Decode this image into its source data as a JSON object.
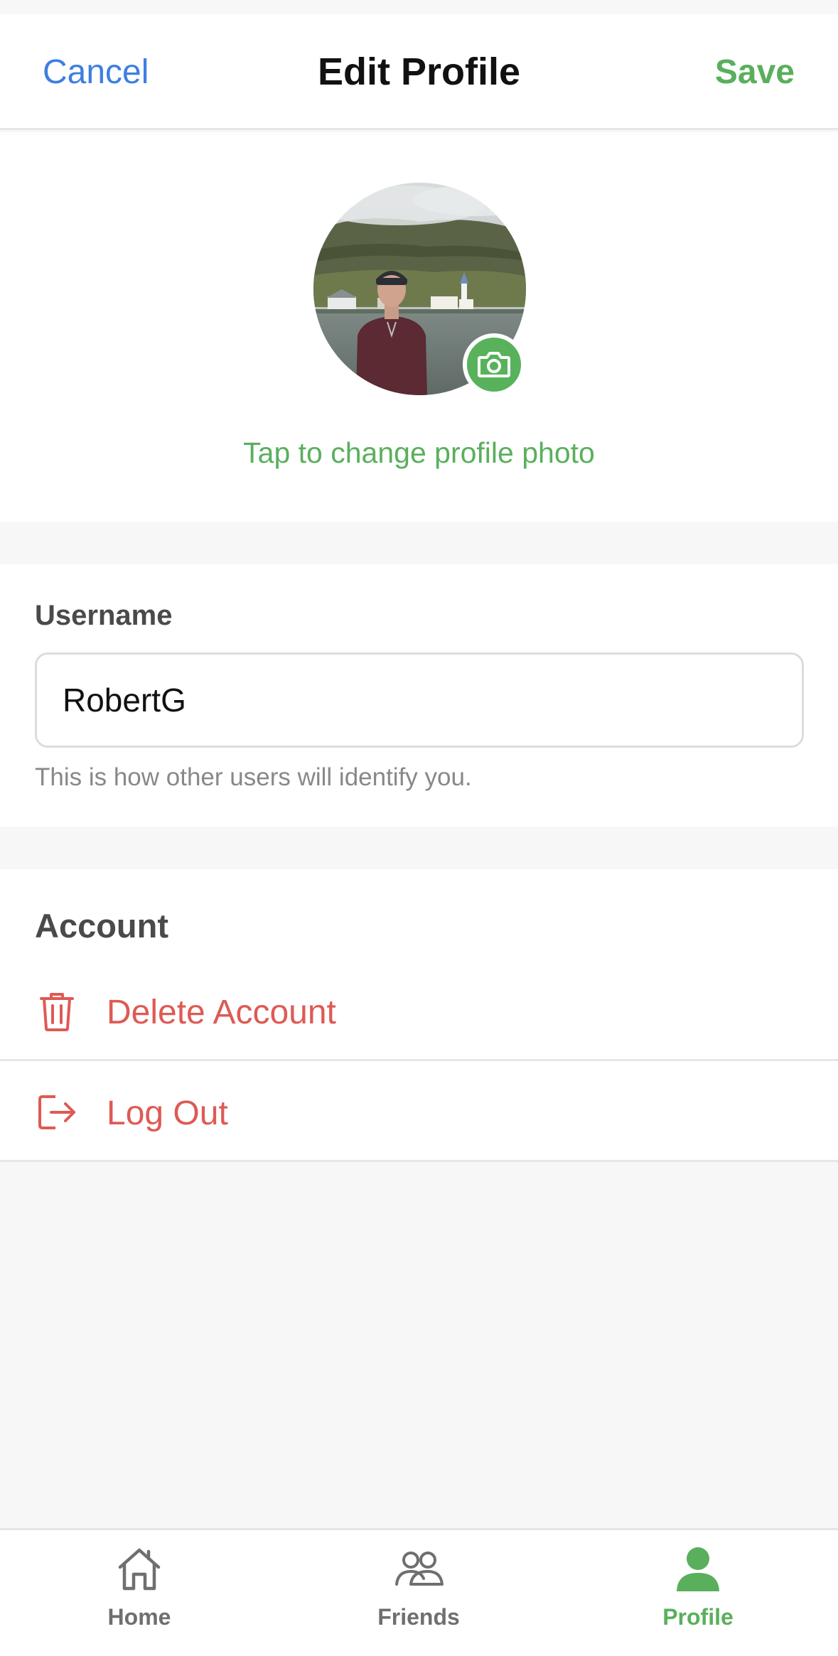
{
  "header": {
    "cancel_label": "Cancel",
    "title": "Edit Profile",
    "save_label": "Save"
  },
  "photo": {
    "change_label": "Tap to change profile photo",
    "badge_icon": "camera-icon"
  },
  "username": {
    "label": "Username",
    "value": "RobertG",
    "hint": "This is how other users will identify you."
  },
  "account": {
    "label": "Account",
    "items": [
      {
        "label": "Delete Account",
        "icon": "trash-icon"
      },
      {
        "label": "Log Out",
        "icon": "logout-icon"
      }
    ]
  },
  "tabbar": {
    "tabs": [
      {
        "label": "Home",
        "icon": "home-icon",
        "active": false
      },
      {
        "label": "Friends",
        "icon": "friends-icon",
        "active": false
      },
      {
        "label": "Profile",
        "icon": "profile-icon",
        "active": true
      }
    ]
  },
  "colors": {
    "accent_green": "#5aaf5d",
    "link_blue": "#3d7fe0",
    "danger_red": "#de5a55",
    "background": "#f7f7f7"
  }
}
